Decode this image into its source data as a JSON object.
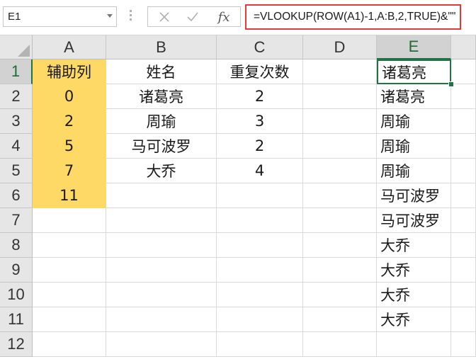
{
  "name_box": {
    "value": "E1"
  },
  "formula_bar": {
    "cancel_icon": "close-icon",
    "enter_icon": "check-icon",
    "function_label": "fx",
    "formula": "=VLOOKUP(ROW(A1)-1,A:B,2,TRUE)&\"\""
  },
  "columns": [
    "A",
    "B",
    "C",
    "D",
    "E"
  ],
  "rows": [
    "1",
    "2",
    "3",
    "4",
    "5",
    "6",
    "7",
    "8",
    "9",
    "10",
    "11",
    "12"
  ],
  "cells": {
    "A": [
      "辅助列",
      "0",
      "2",
      "5",
      "7",
      "11",
      "",
      "",
      "",
      "",
      "",
      ""
    ],
    "B": [
      "姓名",
      "诸葛亮",
      "周瑜",
      "马可波罗",
      "大乔",
      "",
      "",
      "",
      "",
      "",
      "",
      ""
    ],
    "C": [
      "重复次数",
      "2",
      "3",
      "2",
      "4",
      "",
      "",
      "",
      "",
      "",
      "",
      ""
    ],
    "D": [
      "",
      "",
      "",
      "",
      "",
      "",
      "",
      "",
      "",
      "",
      "",
      ""
    ],
    "E": [
      "诸葛亮",
      "诸葛亮",
      "周瑜",
      "周瑜",
      "周瑜",
      "马可波罗",
      "马可波罗",
      "大乔",
      "大乔",
      "大乔",
      "大乔",
      ""
    ]
  },
  "selected_cell": "E1",
  "colors": {
    "highlight_fill": "#ffd966",
    "selection_border": "#217346",
    "formula_border": "#e53935"
  }
}
